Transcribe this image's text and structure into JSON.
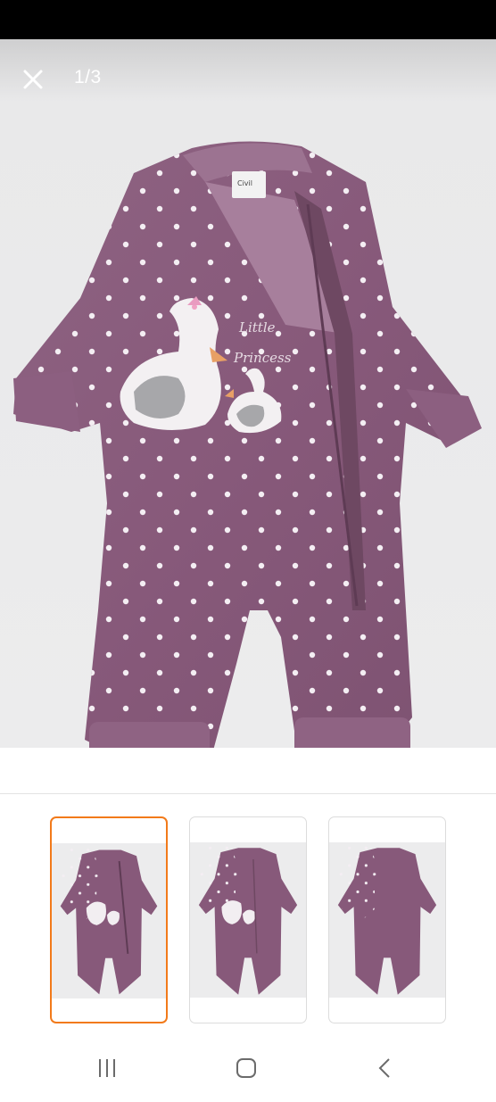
{
  "viewer": {
    "counter": "1/3",
    "close_icon": "close-icon",
    "background": "#ececed",
    "garment_color": "#8a5e7c",
    "main_image_label": "Little Princess"
  },
  "thumbnails": {
    "selected_index": 0,
    "selected_border": "#f27a1a",
    "items": [
      {
        "view": "front-open-zip",
        "selected": true
      },
      {
        "view": "front",
        "selected": false
      },
      {
        "view": "back",
        "selected": false
      }
    ]
  },
  "nav_bar": {
    "recents_icon": "recents-icon",
    "home_icon": "home-icon",
    "back_icon": "back-icon"
  }
}
